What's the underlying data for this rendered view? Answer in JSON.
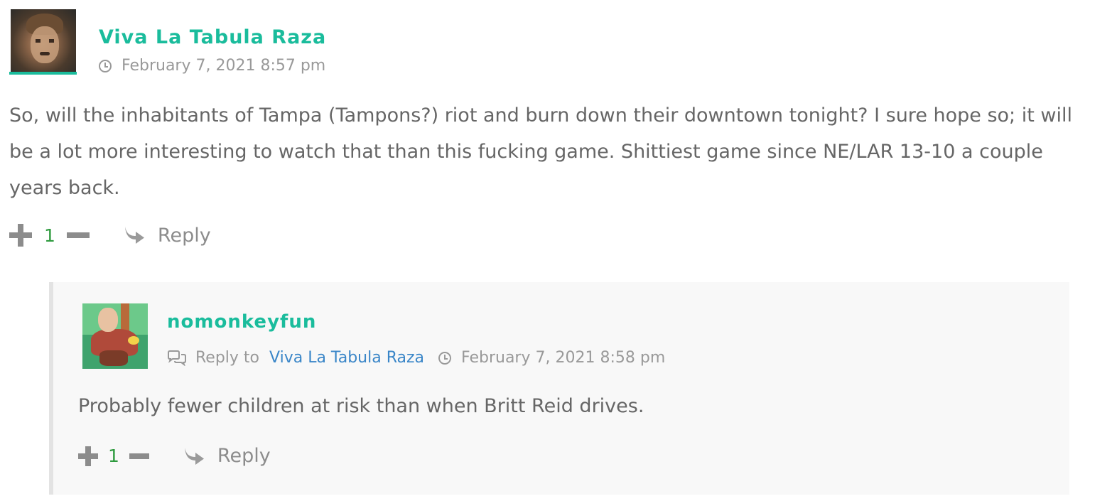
{
  "comments": [
    {
      "author": "Viva La Tabula Raza",
      "date": "February 7, 2021 8:57 pm",
      "text": "So, will the inhabitants of Tampa (Tampons?) riot and burn down their downtown tonight? I sure hope so; it will be a lot more interesting to watch that than this fucking game. Shittiest game since NE/LAR 13-10 a couple years back.",
      "votes": "1",
      "reply_label": "Reply",
      "replies": [
        {
          "author": "nomonkeyfun",
          "reply_to_label": "Reply to",
          "reply_to_author": "Viva La Tabula Raza",
          "date": "February 7, 2021 8:58 pm",
          "text": "Probably fewer children at risk than when Britt Reid drives.",
          "votes": "1",
          "reply_label": "Reply"
        }
      ]
    }
  ],
  "colors": {
    "author": "#1abc9c",
    "link": "#3a86c8",
    "vote_count": "#2e9a3e",
    "meta": "#999999",
    "body_text": "#666666",
    "reply_background": "#f8f8f8"
  },
  "icons": {
    "timestamp": "clock-icon",
    "upvote": "plus-icon",
    "downvote": "minus-icon",
    "reply": "reply-arrow-icon",
    "reply_to": "comments-icon"
  }
}
